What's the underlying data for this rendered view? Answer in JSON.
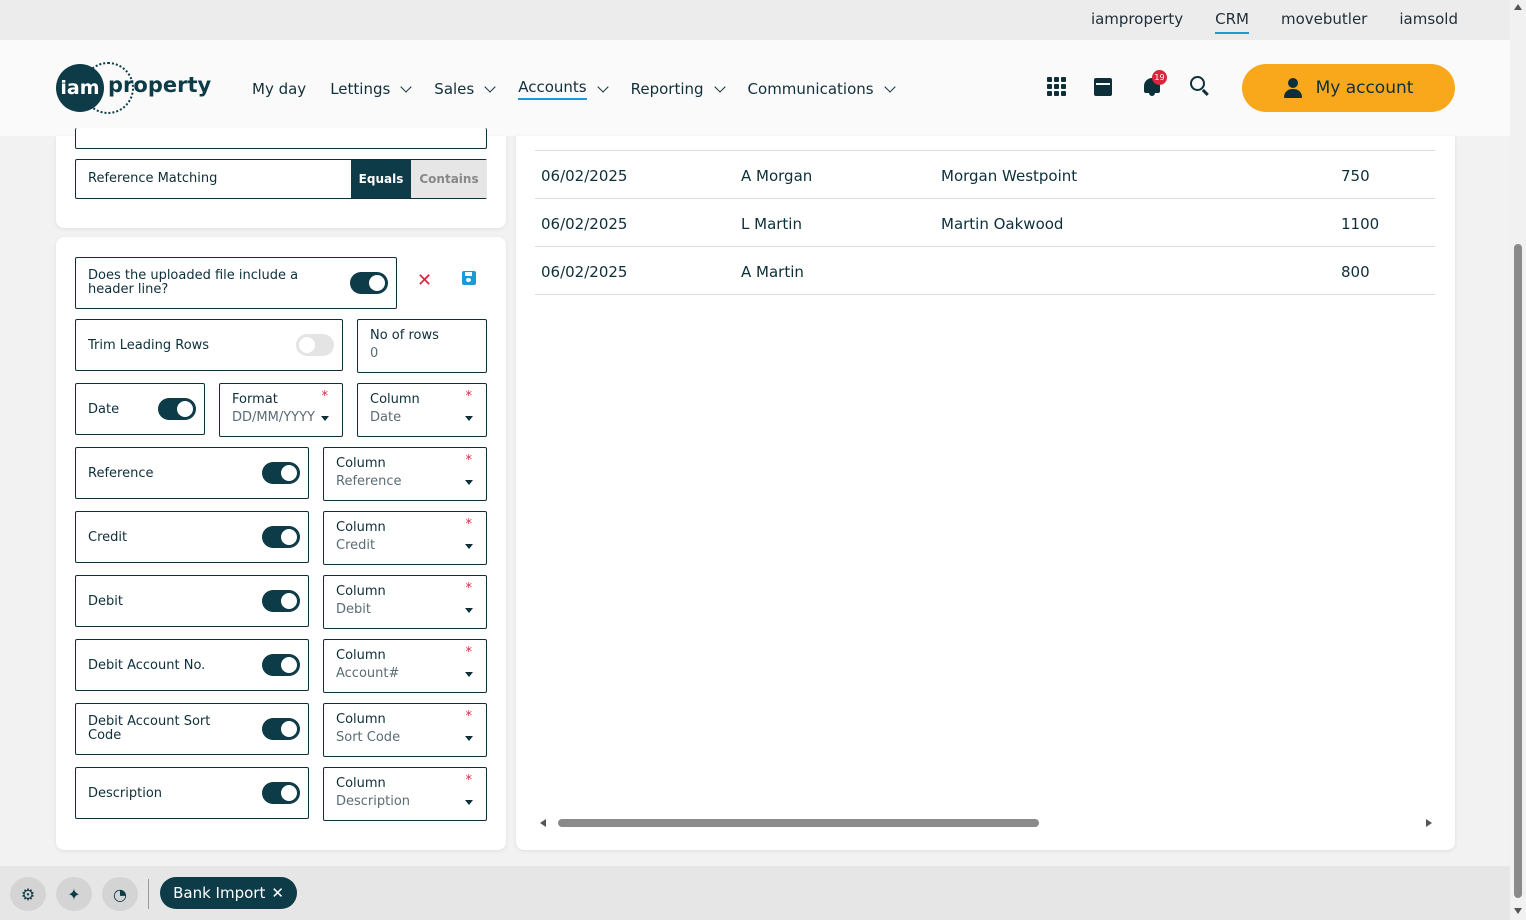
{
  "brand_links": [
    "iamproperty",
    "CRM",
    "movebutler",
    "iamsold"
  ],
  "logo": {
    "mark": "iam",
    "word": "property"
  },
  "nav": [
    {
      "label": "My day",
      "dropdown": false
    },
    {
      "label": "Lettings",
      "dropdown": true
    },
    {
      "label": "Sales",
      "dropdown": true
    },
    {
      "label": "Accounts",
      "dropdown": true,
      "active": true
    },
    {
      "label": "Reporting",
      "dropdown": true
    },
    {
      "label": "Communications",
      "dropdown": true
    }
  ],
  "notifications": {
    "count": "19"
  },
  "account_button": "My account",
  "reference_matching": {
    "label": "Reference Matching",
    "options": [
      "Equals",
      "Contains"
    ],
    "selected": "Equals"
  },
  "header_line": {
    "label": "Does the uploaded file include a header line?",
    "on": true
  },
  "trim_leading": {
    "label": "Trim Leading Rows",
    "on": false
  },
  "no_of_rows": {
    "label": "No of rows",
    "value": "0"
  },
  "date": {
    "label": "Date",
    "on": true,
    "format_label": "Format",
    "format_value": "DD/MM/YYYY",
    "column_label": "Column",
    "column_value": "Date"
  },
  "mappings": [
    {
      "label": "Reference",
      "column_label": "Column",
      "column_value": "Reference"
    },
    {
      "label": "Credit",
      "column_label": "Column",
      "column_value": "Credit"
    },
    {
      "label": "Debit",
      "column_label": "Column",
      "column_value": "Debit"
    },
    {
      "label": "Debit Account No.",
      "column_label": "Column",
      "column_value": "Account#"
    },
    {
      "label": "Debit Account Sort Code",
      "column_label": "Column",
      "column_value": "Sort Code"
    },
    {
      "label": "Description",
      "column_label": "Column",
      "column_value": "Description"
    }
  ],
  "preview_rows": [
    [
      "06/02/2025",
      "A Morgan",
      "Morgan Westpoint",
      "750"
    ],
    [
      "06/02/2025",
      "L Martin",
      "Martin Oakwood",
      "1100"
    ],
    [
      "06/02/2025",
      "A Martin",
      "",
      "800"
    ]
  ],
  "bottom_icons": [
    "gear-icon",
    "book-icon",
    "gauge-icon"
  ],
  "open_tab": {
    "label": "Bank Import",
    "close": "✕"
  },
  "colors": {
    "primary": "#0d3b47",
    "accent": "#f9a81b",
    "link": "#1c9ad6",
    "danger": "#d9263c"
  }
}
